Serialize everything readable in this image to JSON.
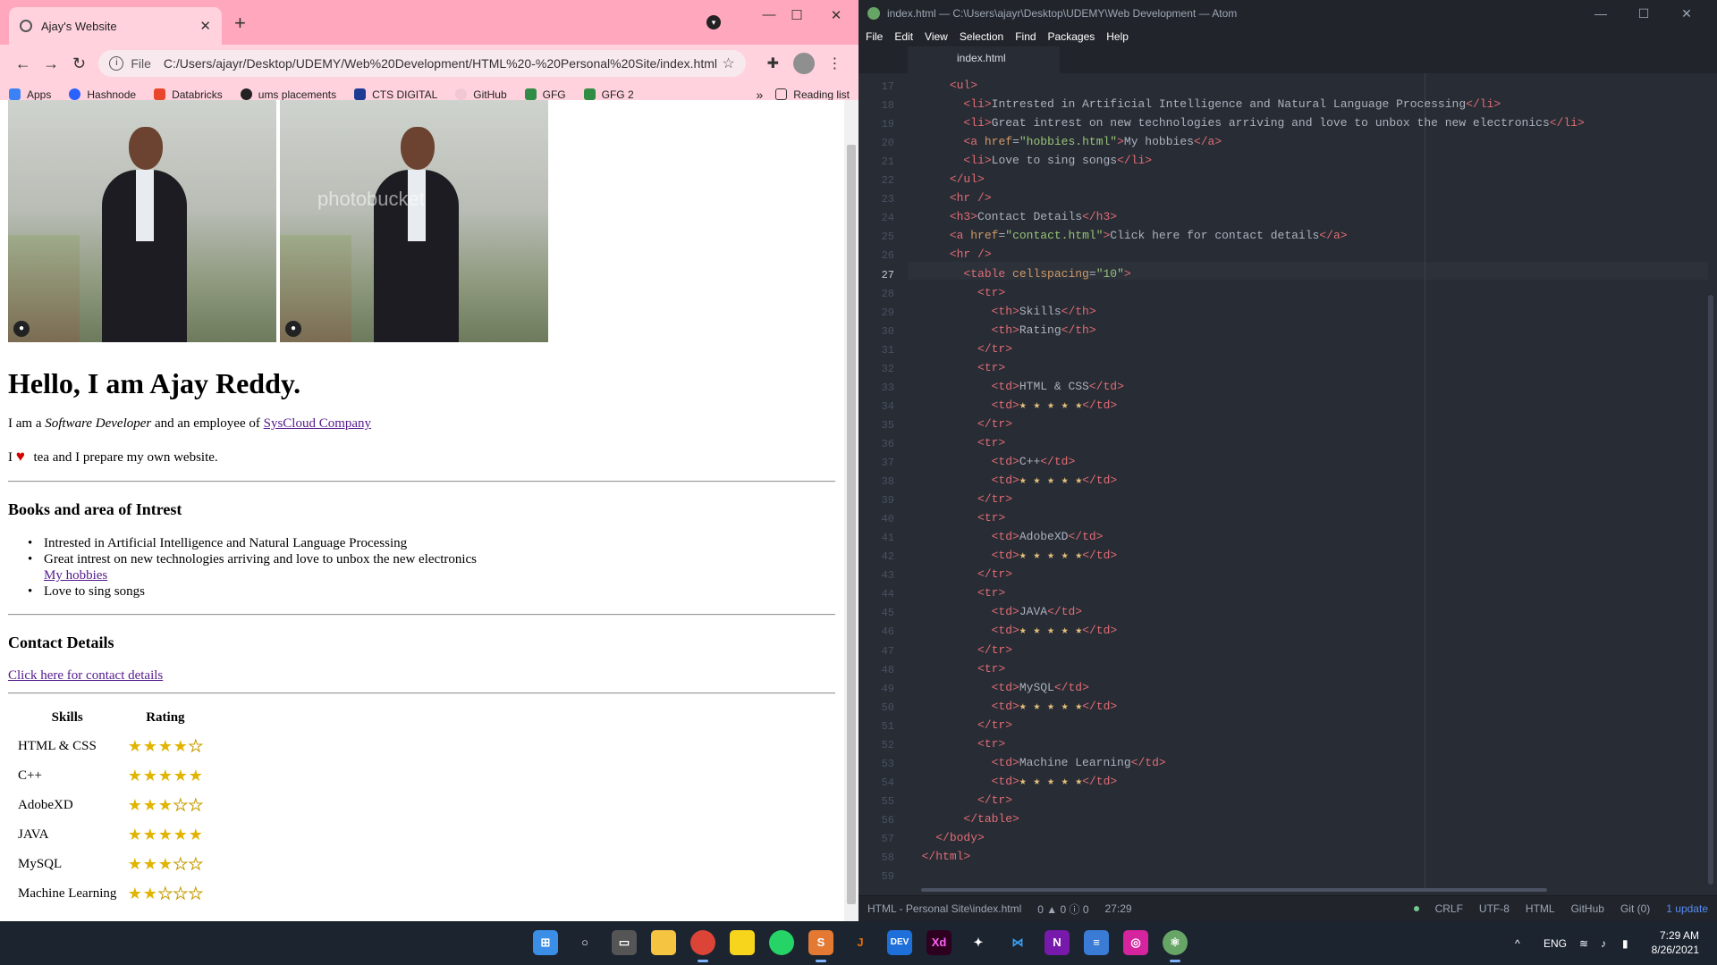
{
  "chrome": {
    "tab_title": "Ajay's Website",
    "url_scheme": "File",
    "url": "C:/Users/ajayr/Desktop/UDEMY/Web%20Development/HTML%20-%20Personal%20Site/index.html",
    "bookmarks": [
      "Apps",
      "Hashnode",
      "Databricks",
      "ums placements",
      "CTS DIGITAL",
      "GitHub",
      "GFG",
      "GFG 2"
    ],
    "reading_list": "Reading list"
  },
  "page": {
    "watermark": "photobucket",
    "heading": "Hello, I am Ajay Reddy.",
    "intro_prefix": "I am a ",
    "intro_role": "Software Developer",
    "intro_mid": " and an employee of ",
    "intro_company": "SysCloud Company",
    "love_prefix": "I ",
    "love_suffix": " tea and I prepare my own website.",
    "books_heading": "Books and area of Intrest",
    "interests": [
      "Intrested in Artificial Intelligence and Natural Language Processing",
      "Great intrest on new technologies arriving and love to unbox the new electronics",
      "My hobbies",
      "Love to sing songs"
    ],
    "contact_heading": "Contact Details",
    "contact_link": "Click here for contact details",
    "table_headers": [
      "Skills",
      "Rating"
    ],
    "skills": [
      {
        "name": "HTML & CSS",
        "stars": 4
      },
      {
        "name": "C++",
        "stars": 5
      },
      {
        "name": "AdobeXD",
        "stars": 3
      },
      {
        "name": "JAVA",
        "stars": 5
      },
      {
        "name": "MySQL",
        "stars": 3
      },
      {
        "name": "Machine Learning",
        "stars": 2
      }
    ]
  },
  "atom": {
    "window_title": "index.html — C:\\Users\\ajayr\\Desktop\\UDEMY\\Web Development — Atom",
    "menu": [
      "File",
      "Edit",
      "View",
      "Selection",
      "Find",
      "Packages",
      "Help"
    ],
    "tab": "index.html",
    "line_numbers": [
      "17",
      "18",
      "19",
      "20",
      "21",
      "22",
      "23",
      "24",
      "25",
      "26",
      "27",
      "28",
      "29",
      "30",
      "31",
      "32",
      "33",
      "34",
      "35",
      "36",
      "37",
      "38",
      "39",
      "40",
      "41",
      "42",
      "43",
      "44",
      "45",
      "46",
      "47",
      "48",
      "49",
      "50",
      "51",
      "52",
      "53",
      "54",
      "55",
      "56",
      "57",
      "58",
      "59"
    ],
    "status": {
      "file": "HTML - Personal Site\\index.html",
      "diagnostics": "0 ▲ 0 ⓘ 0",
      "cursor": "27:29",
      "line_ending": "CRLF",
      "encoding": "UTF-8",
      "grammar": "HTML",
      "github": "GitHub",
      "git": "Git (0)",
      "updates": "1 update"
    }
  },
  "taskbar": {
    "lang": "ENG",
    "time": "7:29 AM",
    "date": "8/26/2021"
  },
  "colors": {
    "chrome_tabstrip": "#ffa8bd",
    "chrome_toolbar": "#ffd2dd",
    "atom_bg": "#282c34",
    "taskbar_bg": "#1c2430"
  }
}
